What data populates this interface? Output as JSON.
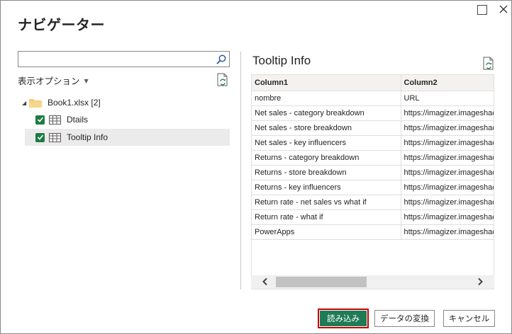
{
  "dialog": {
    "title": "ナビゲーター"
  },
  "left_pane": {
    "search": {
      "value": "",
      "placeholder": ""
    },
    "display_options_label": "表示オプション",
    "tree": {
      "root_label": "Book1.xlsx [2]",
      "items": [
        {
          "label": "Dtails",
          "checked": true,
          "selected": false
        },
        {
          "label": "Tooltip Info",
          "checked": true,
          "selected": true
        }
      ]
    }
  },
  "preview": {
    "title": "Tooltip Info",
    "columns": [
      "Column1",
      "Column2"
    ],
    "rows": [
      [
        "nombre",
        "URL"
      ],
      [
        "Net sales - category breakdown",
        "https://imagizer.imageshack.com"
      ],
      [
        "Net sales - store breakdown",
        "https://imagizer.imageshack.com"
      ],
      [
        "Net sales - key influencers",
        "https://imagizer.imageshack.com"
      ],
      [
        "Returns - category breakdown",
        "https://imagizer.imageshack.com"
      ],
      [
        "Returns - store breakdown",
        "https://imagizer.imageshack.com"
      ],
      [
        "Returns - key influencers",
        "https://imagizer.imageshack.com"
      ],
      [
        "Return rate - net sales vs what if",
        "https://imagizer.imageshack.com"
      ],
      [
        "Return rate - what if",
        "https://imagizer.imageshack.com"
      ],
      [
        "PowerApps",
        "https://imagizer.imageshack.com"
      ]
    ],
    "scroll_fraction": 0.0
  },
  "footer": {
    "load_label": "読み込み",
    "transform_label": "データの変換",
    "cancel_label": "キャンセル"
  },
  "colors": {
    "accent_green": "#1e7b55",
    "checkbox_green": "#1e7b45",
    "highlight_red": "#c00000"
  },
  "icons": [
    "maximize-icon",
    "close-icon",
    "search-icon",
    "refresh-icon",
    "folder-icon",
    "table-icon",
    "checkmark-icon",
    "chevron-left-icon",
    "chevron-right-icon"
  ]
}
